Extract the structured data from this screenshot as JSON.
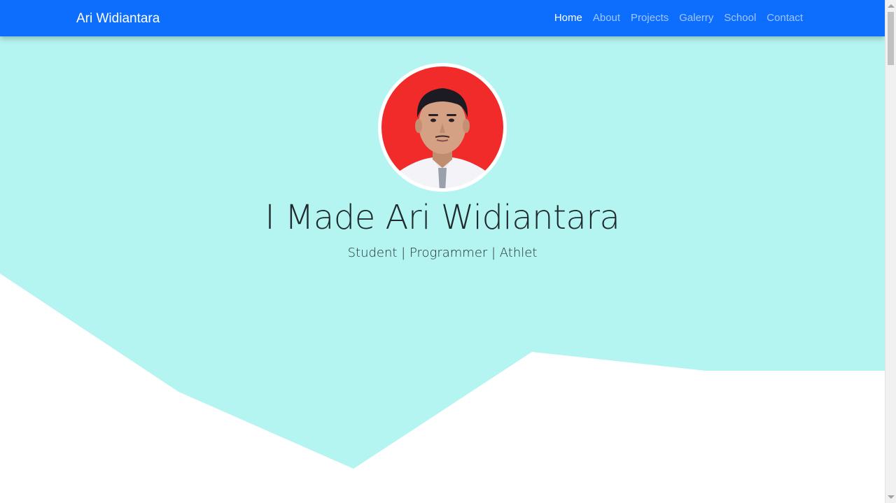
{
  "navbar": {
    "brand": "Ari Widiantara",
    "items": [
      {
        "label": "Home",
        "active": true
      },
      {
        "label": "About",
        "active": false
      },
      {
        "label": "Projects",
        "active": false
      },
      {
        "label": "Galerry",
        "active": false
      },
      {
        "label": "School",
        "active": false
      },
      {
        "label": "Contact",
        "active": false
      }
    ]
  },
  "hero": {
    "profile_image_icon": "profile-photo",
    "name": "I Made Ari Widiantara",
    "tagline": "Student | Programmer | Athlet"
  },
  "colors": {
    "navbar_bg": "#0d6efd",
    "hero_bg": "#b5f5f1",
    "avatar_bg": "#f12a2a"
  }
}
